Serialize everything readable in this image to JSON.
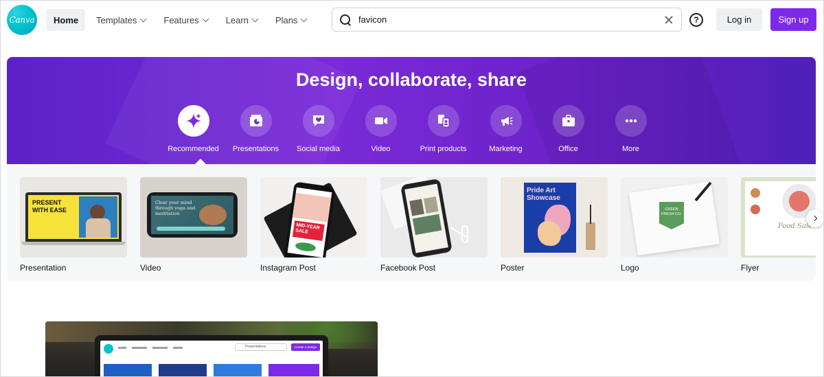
{
  "app": {
    "logo_text": "Canva"
  },
  "nav": {
    "items": [
      {
        "label": "Home",
        "active": true
      },
      {
        "label": "Templates"
      },
      {
        "label": "Features"
      },
      {
        "label": "Learn"
      },
      {
        "label": "Plans"
      }
    ]
  },
  "search": {
    "value": "favicon",
    "placeholder": "Search"
  },
  "help": {
    "glyph": "?"
  },
  "auth": {
    "login": "Log in",
    "signup": "Sign up"
  },
  "hero": {
    "title": "Design, collaborate, share",
    "categories": [
      {
        "label": "Recommended",
        "icon": "sparkle-icon",
        "active": true
      },
      {
        "label": "Presentations",
        "icon": "presentation-icon"
      },
      {
        "label": "Social media",
        "icon": "heart-chat-icon"
      },
      {
        "label": "Video",
        "icon": "video-camera-icon"
      },
      {
        "label": "Print products",
        "icon": "print-icon"
      },
      {
        "label": "Marketing",
        "icon": "megaphone-icon"
      },
      {
        "label": "Office",
        "icon": "briefcase-icon"
      },
      {
        "label": "More",
        "icon": "more-dots-icon"
      }
    ]
  },
  "templates": [
    {
      "label": "Presentation",
      "thumb_text": "PRESENT WITH EASE"
    },
    {
      "label": "Video",
      "thumb_text": "Clear your mind through yoga and meditation"
    },
    {
      "label": "Instagram Post",
      "thumb_text": "MID-YEAR SALE"
    },
    {
      "label": "Facebook Post",
      "thumb_text": ""
    },
    {
      "label": "Poster",
      "thumb_text": "Pride Art Showcase"
    },
    {
      "label": "Logo",
      "thumb_text": "GREEN FRESH CO."
    },
    {
      "label": "Flyer",
      "thumb_text": "Food Sale"
    }
  ],
  "preview_ui": {
    "search_text": "Presentations",
    "button_text": "Create a design"
  },
  "colors": {
    "brand_purple": "#7d2ae8",
    "canva_teal": "#00c4cc",
    "hero_purple": "#6b21c8"
  }
}
